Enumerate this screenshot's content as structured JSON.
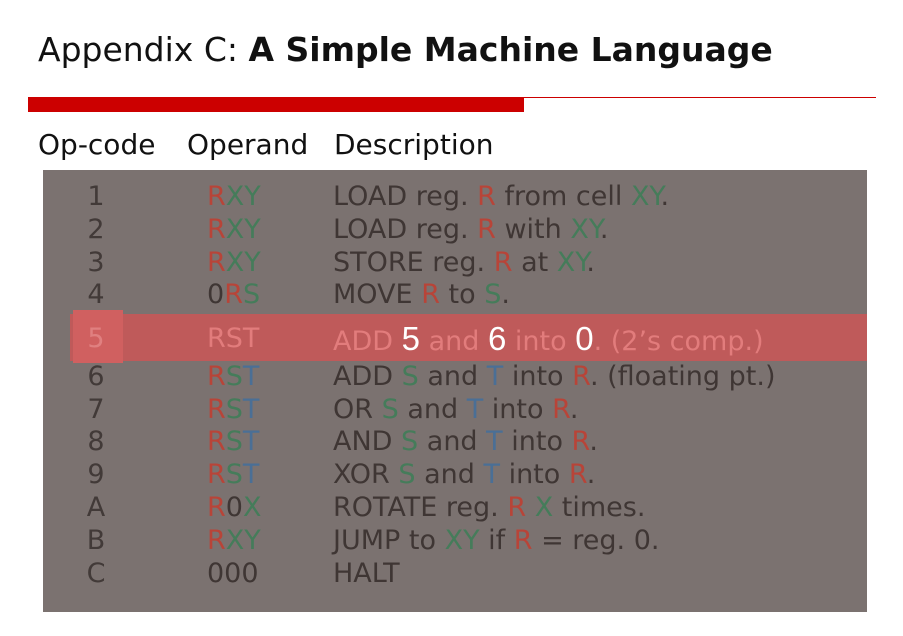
{
  "slide": {
    "title_prefix": "Appendix C: ",
    "title_bold": "A Simple Machine Language"
  },
  "header": {
    "opcode": "Op-code",
    "operand": "Operand",
    "description": "Description"
  },
  "rows": [
    {
      "op": "1",
      "operand": [
        [
          "R",
          "r"
        ],
        [
          "XY",
          "g"
        ]
      ],
      "desc": [
        [
          "LOAD reg. ",
          "dk"
        ],
        [
          "R",
          "r"
        ],
        [
          " from cell ",
          "dk"
        ],
        [
          "XY",
          "g"
        ],
        [
          ".",
          "dk"
        ]
      ]
    },
    {
      "op": "2",
      "operand": [
        [
          "R",
          "r"
        ],
        [
          "XY",
          "g"
        ]
      ],
      "desc": [
        [
          "LOAD reg. ",
          "dk"
        ],
        [
          "R",
          "r"
        ],
        [
          " with ",
          "dk"
        ],
        [
          "XY",
          "g"
        ],
        [
          ".",
          "dk"
        ]
      ]
    },
    {
      "op": "3",
      "operand": [
        [
          "R",
          "r"
        ],
        [
          "XY",
          "g"
        ]
      ],
      "desc": [
        [
          "STORE reg. ",
          "dk"
        ],
        [
          "R",
          "r"
        ],
        [
          " at ",
          "dk"
        ],
        [
          "XY",
          "g"
        ],
        [
          ".",
          "dk"
        ]
      ]
    },
    {
      "op": "4",
      "operand": [
        [
          "0",
          "dk"
        ],
        [
          "R",
          "r"
        ],
        [
          "S",
          "g"
        ]
      ],
      "desc": [
        [
          "MOVE ",
          "dk"
        ],
        [
          "R",
          "r"
        ],
        [
          " to ",
          "dk"
        ],
        [
          "S",
          "g"
        ],
        [
          ".",
          "dk"
        ]
      ]
    },
    {
      "op": "5",
      "operand": [
        [
          "RST",
          "hl"
        ]
      ],
      "desc": [
        [
          "ADD ",
          "hl"
        ],
        [
          "5",
          "w"
        ],
        [
          " and ",
          "hl"
        ],
        [
          "6",
          "w"
        ],
        [
          " into ",
          "hl"
        ],
        [
          "0",
          "w"
        ],
        [
          ". (2’s comp.)",
          "hl"
        ]
      ]
    },
    {
      "op": "6",
      "operand": [
        [
          "R",
          "r"
        ],
        [
          "S",
          "g"
        ],
        [
          "T",
          "b"
        ]
      ],
      "desc": [
        [
          "ADD ",
          "dk"
        ],
        [
          "S",
          "g"
        ],
        [
          " and ",
          "dk"
        ],
        [
          "T",
          "b"
        ],
        [
          " into ",
          "dk"
        ],
        [
          "R",
          "r"
        ],
        [
          ". (floating pt.)",
          "dk"
        ]
      ]
    },
    {
      "op": "7",
      "operand": [
        [
          "R",
          "r"
        ],
        [
          "S",
          "g"
        ],
        [
          "T",
          "b"
        ]
      ],
      "desc": [
        [
          "OR ",
          "dk"
        ],
        [
          "S",
          "g"
        ],
        [
          " and ",
          "dk"
        ],
        [
          "T",
          "b"
        ],
        [
          " into ",
          "dk"
        ],
        [
          "R",
          "r"
        ],
        [
          ".",
          "dk"
        ]
      ]
    },
    {
      "op": "8",
      "operand": [
        [
          "R",
          "r"
        ],
        [
          "S",
          "g"
        ],
        [
          "T",
          "b"
        ]
      ],
      "desc": [
        [
          "AND ",
          "dk"
        ],
        [
          "S",
          "g"
        ],
        [
          " and ",
          "dk"
        ],
        [
          "T",
          "b"
        ],
        [
          " into ",
          "dk"
        ],
        [
          "R",
          "r"
        ],
        [
          ".",
          "dk"
        ]
      ]
    },
    {
      "op": "9",
      "operand": [
        [
          "R",
          "r"
        ],
        [
          "S",
          "g"
        ],
        [
          "T",
          "b"
        ]
      ],
      "desc": [
        [
          "XOR ",
          "dk"
        ],
        [
          "S",
          "g"
        ],
        [
          " and ",
          "dk"
        ],
        [
          "T",
          "b"
        ],
        [
          " into ",
          "dk"
        ],
        [
          "R",
          "r"
        ],
        [
          ".",
          "dk"
        ]
      ]
    },
    {
      "op": "A",
      "operand": [
        [
          "R",
          "r"
        ],
        [
          "0",
          "dk"
        ],
        [
          "X",
          "g"
        ]
      ],
      "desc": [
        [
          "ROTATE reg. ",
          "dk"
        ],
        [
          "R",
          "r"
        ],
        [
          " ",
          "dk"
        ],
        [
          "X",
          "g"
        ],
        [
          " times.",
          "dk"
        ]
      ]
    },
    {
      "op": "B",
      "operand": [
        [
          "R",
          "r"
        ],
        [
          "XY",
          "g"
        ]
      ],
      "desc": [
        [
          "JUMP to ",
          "dk"
        ],
        [
          "XY",
          "g"
        ],
        [
          " if ",
          "dk"
        ],
        [
          "R",
          "r"
        ],
        [
          " = reg. 0.",
          "dk"
        ]
      ]
    },
    {
      "op": "C",
      "operand": [
        [
          "000",
          "dk"
        ]
      ],
      "desc": [
        [
          "HALT",
          "dk"
        ]
      ]
    }
  ],
  "colors": {
    "accent_red": "#cc0000",
    "panel_bg": "#7b7270",
    "register_R": "#b84438",
    "register_XY_S": "#457c5a",
    "register_T": "#4a6f96",
    "highlight": "#c45858"
  }
}
